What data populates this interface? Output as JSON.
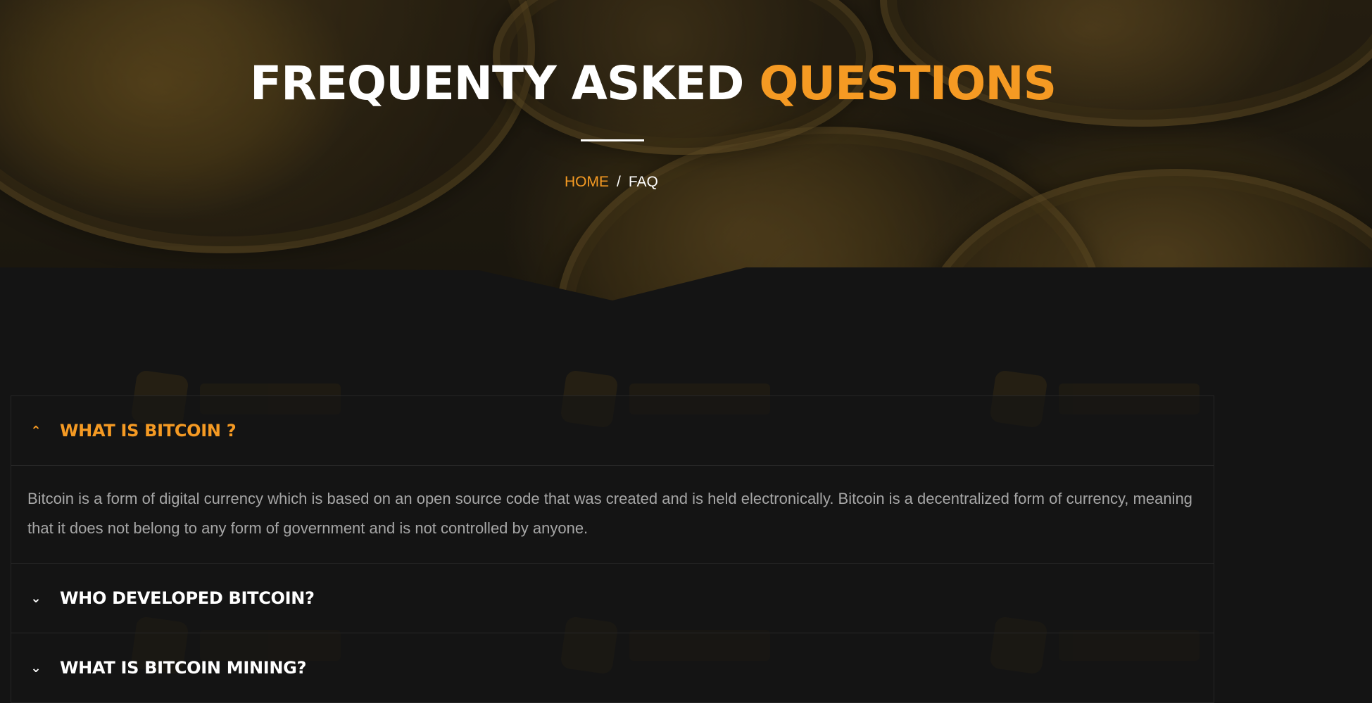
{
  "hero": {
    "title_main": "FREQUENTY ASKED ",
    "title_accent": "QUESTIONS",
    "breadcrumb": {
      "home": "HOME",
      "separator": "/",
      "current": "FAQ"
    }
  },
  "faq": [
    {
      "question": "WHAT IS BITCOIN ?",
      "expanded": true,
      "answer": "Bitcoin is a form of digital currency which is based on an open source code that was created and is held electronically. Bitcoin is a decentralized form of currency, meaning that it does not belong to any form of government and is not controlled by anyone."
    },
    {
      "question": "WHO DEVELOPED BITCOIN?",
      "expanded": false,
      "answer": ""
    },
    {
      "question": "WHAT IS BITCOIN MINING?",
      "expanded": false,
      "answer": ""
    }
  ],
  "icons": {
    "expanded": "chevron-up-icon",
    "collapsed": "chevron-down-icon"
  },
  "colors": {
    "accent": "#f59a23",
    "background": "#141414",
    "text_muted": "#a6a6a6"
  }
}
